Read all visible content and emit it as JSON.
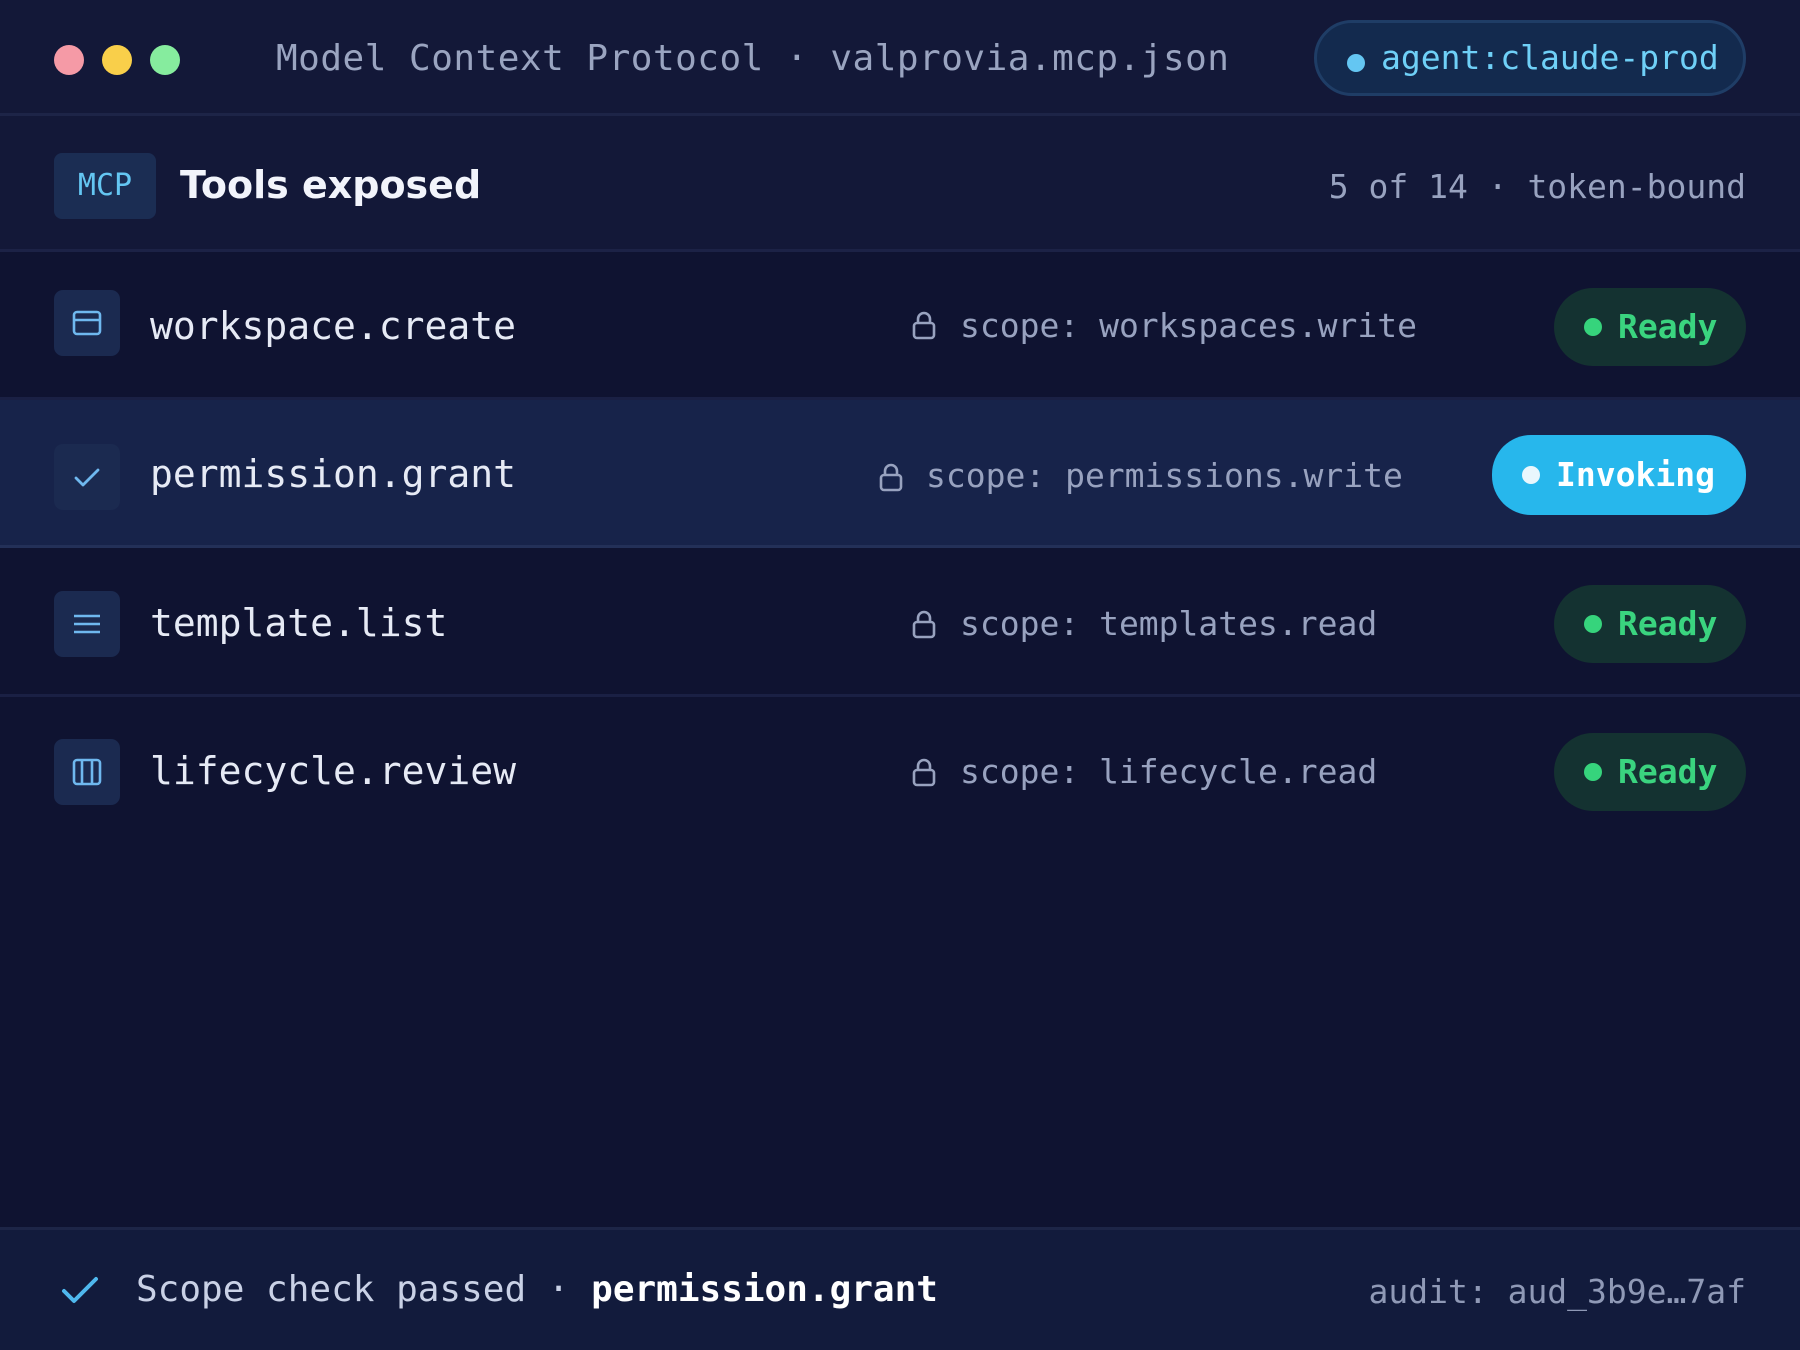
{
  "window": {
    "title": "Model Context Protocol · valprovia.mcp.json",
    "agent_badge": "agent:claude-prod"
  },
  "section": {
    "badge": "MCP",
    "title": "Tools exposed",
    "meta": "5 of 14 · token-bound"
  },
  "tools": [
    {
      "name": "workspace.create",
      "icon": "window-icon",
      "scope": "scope: workspaces.write",
      "status": "Ready"
    },
    {
      "name": "permission.grant",
      "icon": "check-icon",
      "scope": "scope: permissions.write",
      "status": "Invoking"
    },
    {
      "name": "template.list",
      "icon": "list-icon",
      "scope": "scope: templates.read",
      "status": "Ready"
    },
    {
      "name": "lifecycle.review",
      "icon": "columns-icon",
      "scope": "scope: lifecycle.read",
      "status": "Ready"
    }
  ],
  "footer": {
    "icon": "check-icon",
    "message": "Scope check passed · ",
    "tool": "permission.grant",
    "audit": "audit: aud_3b9e…7af"
  },
  "colors": {
    "background": "#0f1331",
    "accent": "#27b7ec",
    "ready": "#3ad47f"
  }
}
